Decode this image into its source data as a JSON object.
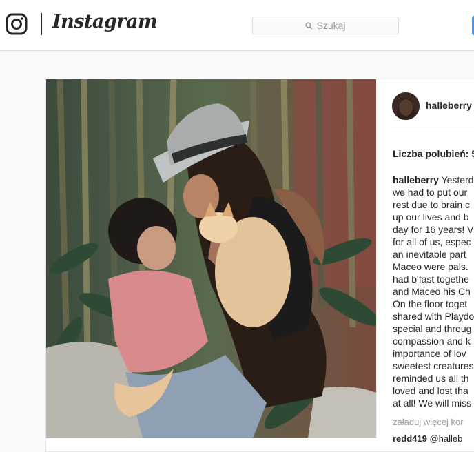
{
  "header": {
    "logo_text": "Instagram",
    "search_placeholder": "Szukaj"
  },
  "post": {
    "username": "halleberry",
    "likes_label": "Liczba polubień: 5",
    "caption_author": "halleberry",
    "caption_lines": [
      "Yesterd",
      "we had to put our",
      "rest due to brain c",
      "up our lives and b",
      "day for 16 years! V",
      "for all of us, espec",
      "an inevitable part",
      "Maceo were pals.",
      "had b'fast togethe",
      "and Maceo his Ch",
      "On the floor toget",
      "shared with Playdo",
      "special and throug",
      "compassion and k",
      "importance of lov",
      "sweetest creatures",
      "reminded us all th",
      "loved and lost tha",
      "at all! We will miss"
    ],
    "load_more": "załaduj więcej kor",
    "comment_peek_user": "redd419",
    "comment_peek_text": " @halleb"
  },
  "icons": {
    "instagram": "instagram-glyph-icon",
    "search": "search-icon"
  }
}
